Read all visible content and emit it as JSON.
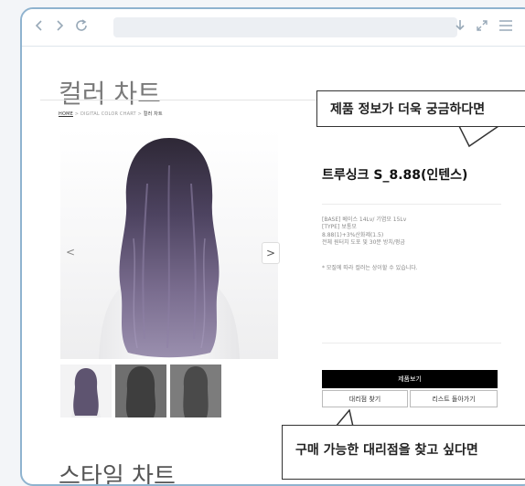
{
  "browser": {
    "back_icon": "chevron-left-icon",
    "forward_icon": "chevron-right-icon",
    "refresh_icon": "refresh-icon",
    "download_icon": "download-icon",
    "expand_icon": "expand-icon",
    "menu_icon": "menu-icon",
    "address_value": ""
  },
  "page": {
    "title": "컬러 차트",
    "breadcrumb": {
      "home": "HOME",
      "sep1": ">",
      "middle": "DIGITAL COLOR CHART",
      "sep2": ">",
      "current": "컬러 차트"
    },
    "bottom_title": "스타일 차트"
  },
  "gallery": {
    "prev_label": "<",
    "next_label": ">",
    "thumbnails": [
      "thumbnail-1",
      "thumbnail-2",
      "thumbnail-3"
    ]
  },
  "product": {
    "name": "트루싱크 S_8.88(인텐스)",
    "spec_lines": [
      "[BASE] 베이스 14Lv/ 기염모 15Lv",
      "[TYPE] 보통모",
      "8.88(1)+3%산화제(1.5)",
      "전체 원터치 도포 및 30분 방치/펑금"
    ],
    "note": "* 모질에 따라 컬러는 상이할 수 있습니다.",
    "buttons": {
      "view_product": "제품보기",
      "find_store": "대리점 찾기",
      "back_to_list": "리스트 돌아가기"
    }
  },
  "callouts": {
    "top": "제품 정보가 더욱 궁금하다면",
    "bottom": "구매 가능한 대리점을 찾고 싶다면"
  },
  "colors": {
    "frame_border": "#8fb3cf",
    "hair": "#5e5470",
    "hair_dark": "#2e2836",
    "primary_button": "#000000"
  }
}
